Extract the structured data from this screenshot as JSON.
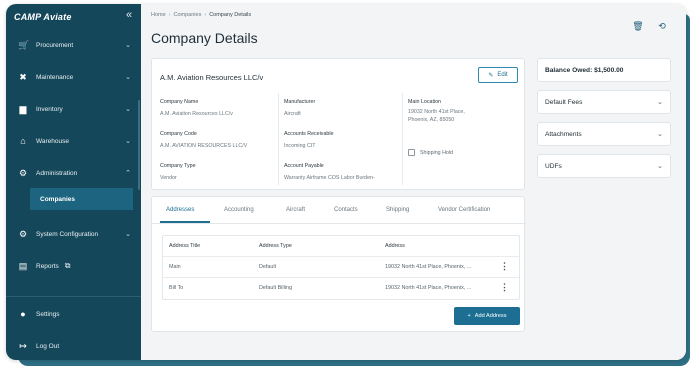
{
  "sidebar": {
    "brand": "CAMP Aviate",
    "collapse_icon": "«",
    "items": [
      {
        "label": "Procurement",
        "icon": "🛒",
        "chev": "⌄"
      },
      {
        "label": "Maintenance",
        "icon": "✖",
        "chev": "⌄"
      },
      {
        "label": "Inventory",
        "icon": "▆",
        "chev": "⌄"
      },
      {
        "label": "Warehouse",
        "icon": "⌂",
        "chev": "⌄"
      },
      {
        "label": "Administration",
        "icon": "⚙",
        "chev": "⌃"
      },
      {
        "label": "System Configuration",
        "icon": "⚙",
        "chev": "⌄"
      },
      {
        "label": "Reports",
        "icon": "▤",
        "ext": "⧉"
      },
      {
        "label": "Settings",
        "icon": "●"
      },
      {
        "label": "Log Out",
        "icon": "↦"
      }
    ],
    "sub_item": "Companies"
  },
  "breadcrumb": {
    "home": "Home",
    "companies": "Companies",
    "current": "Company Details",
    "sep": "›"
  },
  "page_title": "Company Details",
  "top_icons": {
    "delete": "🗑",
    "history": "⟲"
  },
  "company": {
    "name_heading": "A.M. Aviation Resources LLC/v",
    "edit_label": "Edit",
    "fields": {
      "company_name_label": "Company Name",
      "company_name": "A.M. Aviation Resources LLC/v",
      "company_code_label": "Company Code",
      "company_code": "A.M. AVIATION RESOURCES LLC/V",
      "company_type_label": "Company Type",
      "company_type": "Vendor",
      "manufacturer_label": "Manufacturer",
      "manufacturer": "Aircraft",
      "accounts_receivable_label": "Accounts Receivable",
      "accounts_receivable": "Incoming CIT",
      "account_payable_label": "Account Payable",
      "account_payable": "Warranty Airframe COS Labor Burden-",
      "main_location_label": "Main Location",
      "main_location_line1": "19032 North 41st Place,",
      "main_location_line2": "Phoenix, AZ, 85050",
      "shipping_hold_label": "Shipping Hold"
    }
  },
  "tabs": [
    "Addresses",
    "Accounting",
    "Aircraft",
    "Contacts",
    "Shipping",
    "Vendor Certification"
  ],
  "address_table": {
    "headers": [
      "Address Title",
      "Address Type",
      "Address"
    ],
    "rows": [
      [
        "Main",
        "Default",
        "19032 North 41st Place, Phoenix, ..."
      ],
      [
        "Bill To",
        "Default Billing",
        "19032 North 41st Place, Phoenix, ..."
      ]
    ],
    "row_menu": "⋮"
  },
  "add_address_label": "Add Address",
  "right_panel": {
    "balance": "Balance Owed: $1,500.00",
    "sections": [
      "Default Fees",
      "Attachments",
      "UDFs"
    ]
  },
  "colors": {
    "sidebar": "#15475a",
    "accent": "#1c6f93",
    "background": "#f3f4f6"
  }
}
